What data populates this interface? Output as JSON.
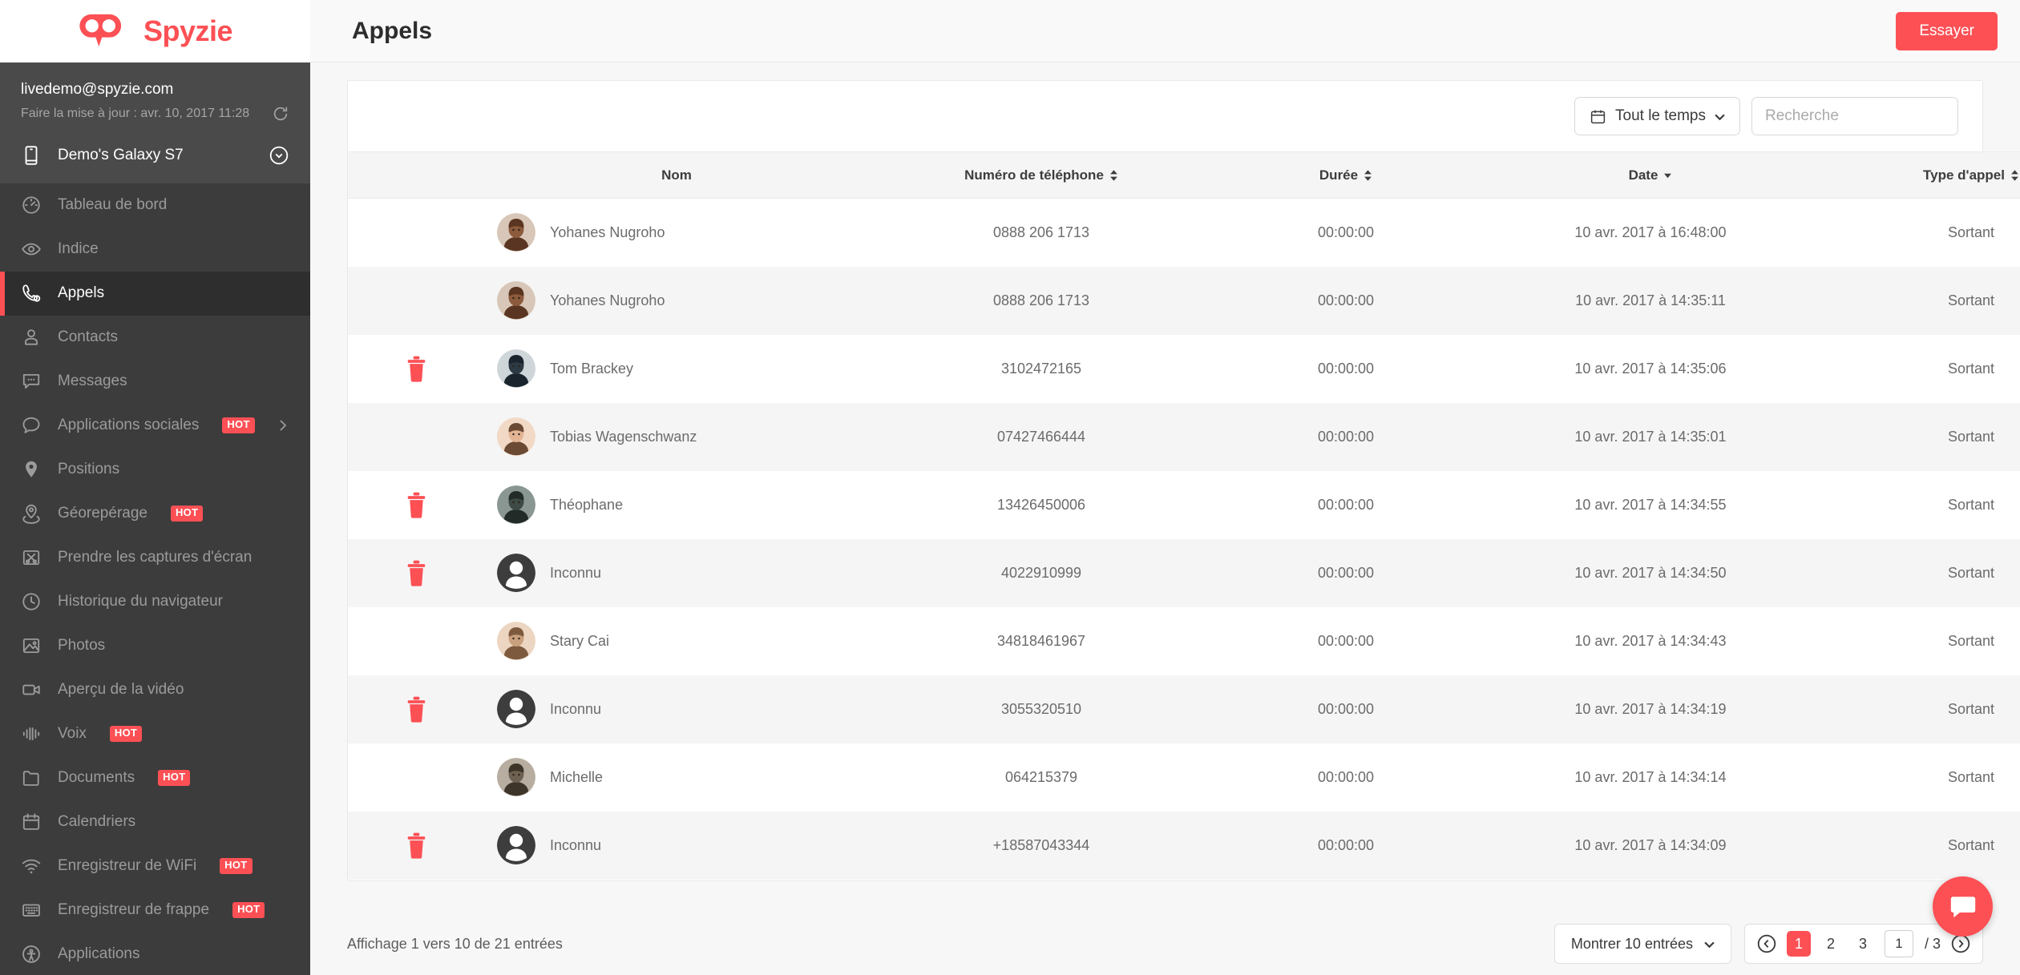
{
  "brand": {
    "name": "Spyzie",
    "accent": "#fc5055",
    "logo_icon": "spyzie-owl-logo"
  },
  "account": {
    "email": "livedemo@spyzie.com",
    "update_text": "Faire la mise à jour : avr. 10, 2017 11:28",
    "refresh_icon": "refresh-icon",
    "device_name": "Demo's Galaxy S7",
    "device_icon": "phone-icon",
    "device_chevron_icon": "chevron-down-circle-icon"
  },
  "sidebar": {
    "items": [
      {
        "label": "Tableau de bord",
        "icon": "dashboard-gauge-icon",
        "active": false,
        "hot": false,
        "arrow": false
      },
      {
        "label": "Indice",
        "icon": "eye-icon",
        "active": false,
        "hot": false,
        "arrow": false
      },
      {
        "label": "Appels",
        "icon": "phone-call-icon",
        "active": true,
        "hot": false,
        "arrow": false
      },
      {
        "label": "Contacts",
        "icon": "person-icon",
        "active": false,
        "hot": false,
        "arrow": false
      },
      {
        "label": "Messages",
        "icon": "message-bubble-icon",
        "active": false,
        "hot": false,
        "arrow": false
      },
      {
        "label": "Applications sociales",
        "icon": "chat-bubble-icon",
        "active": false,
        "hot": true,
        "arrow": true
      },
      {
        "label": "Positions",
        "icon": "map-pin-icon",
        "active": false,
        "hot": false,
        "arrow": false
      },
      {
        "label": "Géorepérage",
        "icon": "geofence-icon",
        "active": false,
        "hot": true,
        "arrow": false
      },
      {
        "label": "Prendre les captures d'écran",
        "icon": "screenshot-scissors-icon",
        "active": false,
        "hot": false,
        "arrow": false
      },
      {
        "label": "Historique du navigateur",
        "icon": "clock-history-icon",
        "active": false,
        "hot": false,
        "arrow": false
      },
      {
        "label": "Photos",
        "icon": "image-icon",
        "active": false,
        "hot": false,
        "arrow": false
      },
      {
        "label": "Aperçu de la vidéo",
        "icon": "video-camera-icon",
        "active": false,
        "hot": false,
        "arrow": false
      },
      {
        "label": "Voix",
        "icon": "waveform-icon",
        "active": false,
        "hot": true,
        "arrow": false
      },
      {
        "label": "Documents",
        "icon": "folder-icon",
        "active": false,
        "hot": true,
        "arrow": false
      },
      {
        "label": "Calendriers",
        "icon": "calendar-icon",
        "active": false,
        "hot": false,
        "arrow": false
      },
      {
        "label": "Enregistreur de WiFi",
        "icon": "wifi-icon",
        "active": false,
        "hot": true,
        "arrow": false
      },
      {
        "label": "Enregistreur de frappe",
        "icon": "keyboard-icon",
        "active": false,
        "hot": true,
        "arrow": false
      },
      {
        "label": "Applications",
        "icon": "apps-icon",
        "active": false,
        "hot": false,
        "arrow": false
      }
    ],
    "hot_badge_label": "HOT"
  },
  "topbar": {
    "title": "Appels",
    "try_label": "Essayer"
  },
  "toolbar": {
    "date_filter_label": "Tout le temps",
    "date_filter_icon": "calendar-icon",
    "date_filter_chevron": "chevron-down-icon",
    "search_placeholder": "Recherche",
    "search_value": "",
    "search_icon": "search-icon"
  },
  "table": {
    "columns": [
      {
        "label": "",
        "sortable": false
      },
      {
        "label": "Nom",
        "sortable": false
      },
      {
        "label": "Numéro de téléphone",
        "sortable": true,
        "sort": "none"
      },
      {
        "label": "Durée",
        "sortable": true,
        "sort": "none"
      },
      {
        "label": "Date",
        "sortable": true,
        "sort": "desc"
      },
      {
        "label": "Type d'appel",
        "sortable": true,
        "sort": "none"
      }
    ],
    "rows": [
      {
        "deletable": false,
        "avatar": "photo-male-1",
        "name": "Yohanes Nugroho",
        "phone": "0888 206 1713",
        "duration": "00:00:00",
        "date": "10 avr. 2017 à 16:48:00",
        "type": "Sortant"
      },
      {
        "deletable": false,
        "avatar": "photo-male-1",
        "name": "Yohanes Nugroho",
        "phone": "0888 206 1713",
        "duration": "00:00:00",
        "date": "10 avr. 2017 à 14:35:11",
        "type": "Sortant"
      },
      {
        "deletable": true,
        "avatar": "photo-male-2",
        "name": "Tom Brackey",
        "phone": "3102472165",
        "duration": "00:00:00",
        "date": "10 avr. 2017 à 14:35:06",
        "type": "Sortant"
      },
      {
        "deletable": false,
        "avatar": "photo-female-1",
        "name": "Tobias Wagenschwanz",
        "phone": "07427466444",
        "duration": "00:00:00",
        "date": "10 avr. 2017 à 14:35:01",
        "type": "Sortant"
      },
      {
        "deletable": true,
        "avatar": "photo-dark-1",
        "name": "Théophane",
        "phone": "13426450006",
        "duration": "00:00:00",
        "date": "10 avr. 2017 à 14:34:55",
        "type": "Sortant"
      },
      {
        "deletable": true,
        "avatar": "avatar-placeholder",
        "name": "Inconnu",
        "phone": "4022910999",
        "duration": "00:00:00",
        "date": "10 avr. 2017 à 14:34:50",
        "type": "Sortant"
      },
      {
        "deletable": false,
        "avatar": "photo-female-2",
        "name": "Stary Cai",
        "phone": "34818461967",
        "duration": "00:00:00",
        "date": "10 avr. 2017 à 14:34:43",
        "type": "Sortant"
      },
      {
        "deletable": true,
        "avatar": "avatar-placeholder",
        "name": "Inconnu",
        "phone": "3055320510",
        "duration": "00:00:00",
        "date": "10 avr. 2017 à 14:34:19",
        "type": "Sortant"
      },
      {
        "deletable": false,
        "avatar": "photo-male-3",
        "name": "Michelle",
        "phone": "064215379",
        "duration": "00:00:00",
        "date": "10 avr. 2017 à 14:34:14",
        "type": "Sortant"
      },
      {
        "deletable": true,
        "avatar": "avatar-placeholder",
        "name": "Inconnu",
        "phone": "+18587043344",
        "duration": "00:00:00",
        "date": "10 avr. 2017 à 14:34:09",
        "type": "Sortant"
      }
    ]
  },
  "footer": {
    "entries_info": "Affichage 1 vers 10 de 21 entrées",
    "show_entries_label": "Montrer 10 entrées",
    "pages": [
      "1",
      "2",
      "3"
    ],
    "current_page": "1",
    "page_input_value": "1",
    "total_pages": "/ 3",
    "prev_icon": "chevron-left-circle-icon",
    "next_icon": "chevron-right-circle-icon"
  },
  "chat_fab": {
    "icon": "chat-bubble-icon"
  }
}
